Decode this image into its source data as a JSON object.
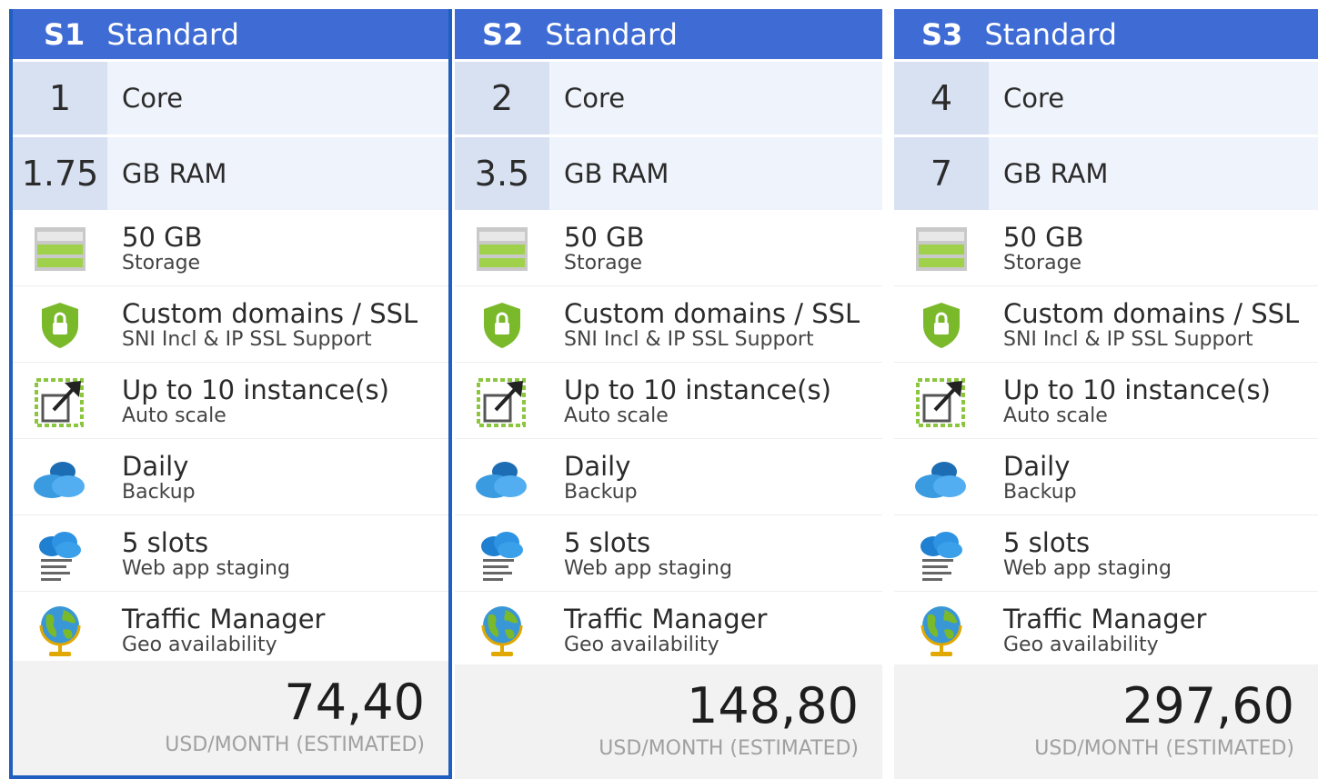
{
  "plans": [
    {
      "tier": "S1",
      "name": "Standard",
      "cores": "1",
      "cores_label": "Core",
      "ram": "1.75",
      "ram_label": "GB RAM",
      "features": [
        {
          "icon": "storage-icon",
          "main": "50 GB",
          "sub": "Storage"
        },
        {
          "icon": "ssl-shield-icon",
          "main": "Custom domains / SSL",
          "sub": "SNI Incl & IP SSL Support"
        },
        {
          "icon": "autoscale-icon",
          "main": "Up to 10 instance(s)",
          "sub": "Auto scale"
        },
        {
          "icon": "backup-cloud-icon",
          "main": "Daily",
          "sub": "Backup"
        },
        {
          "icon": "staging-slots-icon",
          "main": "5 slots",
          "sub": "Web app staging"
        },
        {
          "icon": "globe-icon",
          "main": "Traffic Manager",
          "sub": "Geo availability"
        }
      ],
      "price": "74,40",
      "price_unit": "USD/MONTH (ESTIMATED)"
    },
    {
      "tier": "S2",
      "name": "Standard",
      "cores": "2",
      "cores_label": "Core",
      "ram": "3.5",
      "ram_label": "GB RAM",
      "features": [
        {
          "icon": "storage-icon",
          "main": "50 GB",
          "sub": "Storage"
        },
        {
          "icon": "ssl-shield-icon",
          "main": "Custom domains / SSL",
          "sub": "SNI Incl & IP SSL Support"
        },
        {
          "icon": "autoscale-icon",
          "main": "Up to 10 instance(s)",
          "sub": "Auto scale"
        },
        {
          "icon": "backup-cloud-icon",
          "main": "Daily",
          "sub": "Backup"
        },
        {
          "icon": "staging-slots-icon",
          "main": "5 slots",
          "sub": "Web app staging"
        },
        {
          "icon": "globe-icon",
          "main": "Traffic Manager",
          "sub": "Geo availability"
        }
      ],
      "price": "148,80",
      "price_unit": "USD/MONTH (ESTIMATED)"
    },
    {
      "tier": "S3",
      "name": "Standard",
      "cores": "4",
      "cores_label": "Core",
      "ram": "7",
      "ram_label": "GB RAM",
      "features": [
        {
          "icon": "storage-icon",
          "main": "50 GB",
          "sub": "Storage"
        },
        {
          "icon": "ssl-shield-icon",
          "main": "Custom domains / SSL",
          "sub": "SNI Incl & IP SSL Support"
        },
        {
          "icon": "autoscale-icon",
          "main": "Up to 10 instance(s)",
          "sub": "Auto scale"
        },
        {
          "icon": "backup-cloud-icon",
          "main": "Daily",
          "sub": "Backup"
        },
        {
          "icon": "staging-slots-icon",
          "main": "5 slots",
          "sub": "Web app staging"
        },
        {
          "icon": "globe-icon",
          "main": "Traffic Manager",
          "sub": "Geo availability"
        }
      ],
      "price": "297,60",
      "price_unit": "USD/MONTH (ESTIMATED)"
    }
  ],
  "colors": {
    "header": "#3f6bd4",
    "selected_border": "#1f5fbf",
    "spec_number_bg": "#d7e1f2",
    "spec_bg": "#eff3fb",
    "icon_green": "#7ab929",
    "icon_blue": "#2f8fd8"
  },
  "selected_plan": "S1"
}
